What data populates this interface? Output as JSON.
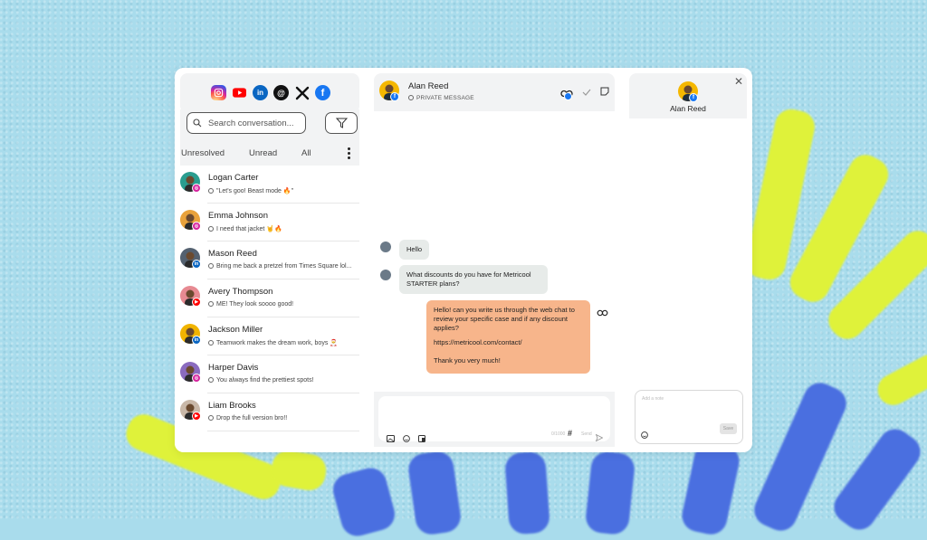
{
  "socials": [
    "instagram-icon",
    "youtube-icon",
    "linkedin-icon",
    "threads-icon",
    "x-icon",
    "facebook-icon"
  ],
  "search": {
    "placeholder": "Search conversation..."
  },
  "tabs": {
    "unresolved": "Unresolved",
    "unread": "Unread",
    "all": "All"
  },
  "conversations": [
    {
      "name": "Logan Carter",
      "message": "\"Let's goo! Beast mode 🔥\"",
      "network": "instagram",
      "avatar_color": "#2a9d8f"
    },
    {
      "name": "Emma Johnson",
      "message": "I need that jacket 🤘🔥",
      "network": "instagram",
      "avatar_color": "#e9a23b"
    },
    {
      "name": "Mason Reed",
      "message": "Bring me back a pretzel from Times Square lol...",
      "network": "linkedin",
      "avatar_color": "#546170"
    },
    {
      "name": "Avery Thompson",
      "message": "ME! They look soooo good!",
      "network": "youtube",
      "avatar_color": "#e78a92"
    },
    {
      "name": "Jackson Miller",
      "message": "Teamwork makes the dream work, boys 🎅",
      "network": "linkedin",
      "avatar_color": "#f1b400"
    },
    {
      "name": "Harper Davis",
      "message": "You always find the prettiest spots!",
      "network": "instagram",
      "avatar_color": "#8a6bbf"
    },
    {
      "name": "Liam Brooks",
      "message": "Drop the full version bro!!",
      "network": "youtube",
      "avatar_color": "#c9b8a8"
    }
  ],
  "chat": {
    "contact_name": "Alan Reed",
    "channel_label": "PRIVATE MESSAGE",
    "messages": [
      {
        "direction": "in",
        "text": "Hello"
      },
      {
        "direction": "in",
        "text": "What discounts do you have for Metricool STARTER plans?"
      },
      {
        "direction": "out",
        "paragraphs": [
          "Hello! can you write us through the web chat to review your specific case and if any discount applies?",
          "https://metricool.com/contact/",
          "Thank you very much!"
        ]
      }
    ],
    "composer": {
      "char_count": "0/1000",
      "hash": "#",
      "send_label": "Send"
    }
  },
  "profile": {
    "name": "Alan Reed",
    "note_placeholder": "Add a note",
    "save_label": "Save"
  },
  "colors": {
    "background": "#a9dcec",
    "outgoing_bubble": "#f7b58b",
    "incoming_bubble": "#e7ebe9",
    "instagram": "#d6249f",
    "youtube": "#ff0000",
    "linkedin": "#0a66c2",
    "facebook": "#1877f2"
  }
}
